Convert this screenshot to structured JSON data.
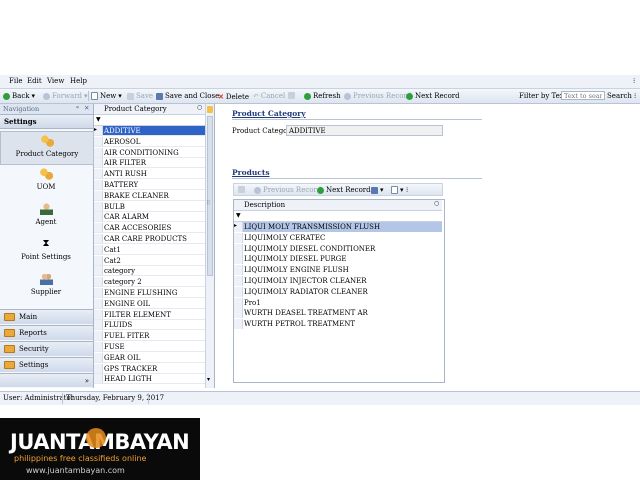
{
  "menu": [
    "File",
    "Edit",
    "View",
    "Help"
  ],
  "toolbar": {
    "back": "Back",
    "forward": "Forward",
    "new": "New",
    "save": "Save",
    "save_close": "Save and Close",
    "delete": "Delete",
    "cancel": "Cancel",
    "refresh": "Refresh",
    "prev": "Previous Record",
    "next": "Next Record",
    "filter_label": "Filter by Text",
    "filter_placeholder": "Text to sear",
    "search": "Search"
  },
  "nav": {
    "header": "Navigation",
    "group": "Settings",
    "items": [
      "Product Category",
      "UOM",
      "Agent",
      "Point Settings",
      "Supplier"
    ],
    "bottom_groups": [
      "Main",
      "Reports",
      "Security",
      "Settings"
    ]
  },
  "category_list": {
    "header": "Product Category",
    "items": [
      "ADDITIVE",
      "AEROSOL",
      "AIR CONDITIONING",
      "AIR FILTER",
      "ANTI RUSH",
      "BATTERY",
      "BRAKE CLEANER",
      "BULB",
      "CAR  ALARM",
      "CAR ACCESORIES",
      "CAR CARE PRODUCTS",
      "Cat1",
      "Cat2",
      "category",
      "category 2",
      "ENGINE FLUSHING",
      "ENGINE OIL",
      "FILTER ELEMENT",
      "FLUIDS",
      "FUEL FITER",
      "FUSE",
      "GEAR OIL",
      "GPS TRACKER",
      "HEAD LIGTH"
    ]
  },
  "detail": {
    "section_title": "Product Category",
    "field_label": "Product Category:",
    "field_value": "ADDITIVE",
    "products_title": "Products",
    "prev": "Previous Record",
    "next": "Next Record",
    "grid_header": "Description",
    "products": [
      "LIQUI MOLY TRANSMISSION FLUSH",
      "LIQUIMOLY CERATEC",
      "LIQUIMOLY DIESEL CONDITIONER",
      "LIQUIMOLY DIESEL PURGE",
      "LIQUIMOLY ENGINE FLUSH",
      "LIQUIMOLY INJECTOR CLEANER",
      "LIQUIMOLY RADIATOR CLEANER",
      "Pro1",
      "WURTH DEASEL TREATMENT AR",
      "WURTH PETROL TREATMENT"
    ]
  },
  "status": {
    "user": "User: Administrator",
    "date": "Thursday, February 9, 2017"
  },
  "watermark": {
    "brand": "JUANTAMBAYAN",
    "tagline": "philippines free classifieds online",
    "url": "www.juantambayan.com"
  },
  "colors": {
    "selection": "#2f63c6",
    "accent_green": "#2e9e3e",
    "accent_orange": "#e6a93a"
  }
}
